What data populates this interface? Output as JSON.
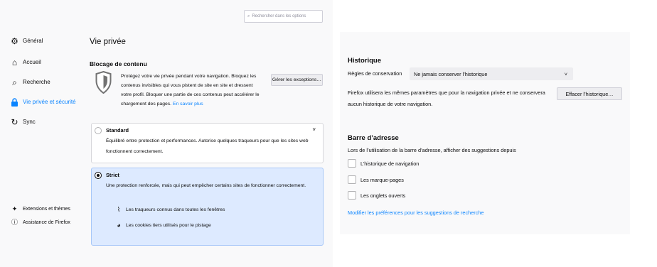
{
  "search": {
    "placeholder": "Rechercher dans les options",
    "icon": "search-icon"
  },
  "sidebar": {
    "items": [
      {
        "label": "Général",
        "icon": "gear-icon"
      },
      {
        "label": "Accueil",
        "icon": "home-icon"
      },
      {
        "label": "Recherche",
        "icon": "search-icon"
      },
      {
        "label": "Vie privée et sécurité",
        "icon": "lock-icon",
        "active": true
      },
      {
        "label": "Sync",
        "icon": "sync-icon"
      }
    ],
    "footer": [
      {
        "label": "Extensions et thèmes",
        "icon": "puzzle-icon"
      },
      {
        "label": "Assistance de Firefox",
        "icon": "help-icon"
      }
    ]
  },
  "main": {
    "title": "Vie privée",
    "blocking": {
      "heading": "Blocage de contenu",
      "intro": "Protégez votre vie privée pendant votre navigation. Bloquez les contenus invisibles qui vous pistent de site en site et dressent votre profil. Bloquer une partie de ces contenus peut accélérer le chargement des pages.",
      "learn_more": "En savoir plus",
      "exceptions_button": "Gérer les exceptions…",
      "standard": {
        "label": "Standard",
        "description": "Équilibré entre protection et performances. Autorise quelques traqueurs pour que les sites web fonctionnent correctement."
      },
      "strict": {
        "label": "Strict",
        "description": "Une protection renforcée, mais qui peut empêcher certains sites de fonctionner correctement.",
        "features": [
          "Les traqueurs connus dans toutes les fenêtres",
          "Les cookies tiers utilisés pour le pistage"
        ]
      }
    }
  },
  "history": {
    "heading": "Historique",
    "rules_label": "Règles de conservation",
    "rules_value": "Ne jamais conserver l’historique",
    "description": "Firefox utilisera les mêmes paramètres que pour la navigation privée et ne conservera aucun historique de votre navigation.",
    "clear_button": "Effacer l’historique…"
  },
  "address_bar": {
    "heading": "Barre d’adresse",
    "description": "Lors de l’utilisation de la barre d’adresse, afficher des suggestions depuis",
    "options": [
      "L’historique de navigation",
      "Les marque-pages",
      "Les onglets ouverts"
    ],
    "link": "Modifier les préférences pour les suggestions de recherche"
  },
  "colors": {
    "accent": "#0a84ff",
    "strict_bg": "#ddeaff",
    "panel_bg": "#f9f9fa"
  }
}
